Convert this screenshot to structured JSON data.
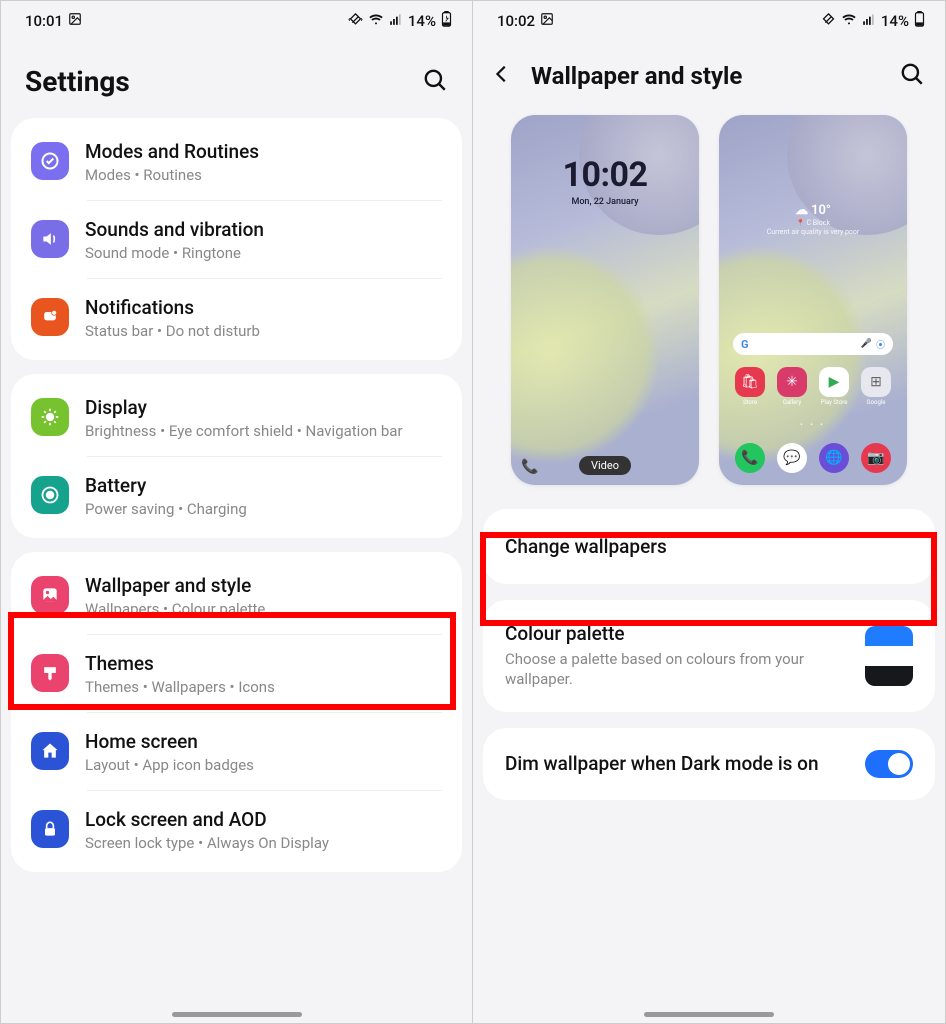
{
  "status": {
    "time_left": "10:01",
    "time_right": "10:02",
    "battery": "14%"
  },
  "left": {
    "header_title": "Settings",
    "items": [
      {
        "title": "Modes and Routines",
        "sub": "Modes  •  Routines",
        "icon": "check-circle",
        "bg": "bg-purple"
      },
      {
        "title": "Sounds and vibration",
        "sub": "Sound mode  •  Ringtone",
        "icon": "speaker",
        "bg": "bg-violet"
      },
      {
        "title": "Notifications",
        "sub": "Status bar  •  Do not disturb",
        "icon": "bell",
        "bg": "bg-orange"
      },
      {
        "title": "Display",
        "sub": "Brightness  •  Eye comfort shield  •  Navigation bar",
        "icon": "sun",
        "bg": "bg-green"
      },
      {
        "title": "Battery",
        "sub": "Power saving  •  Charging",
        "icon": "battery",
        "bg": "bg-teal"
      },
      {
        "title": "Wallpaper and style",
        "sub": "Wallpapers  •  Colour palette",
        "icon": "picture",
        "bg": "bg-pink"
      },
      {
        "title": "Themes",
        "sub": "Themes  •  Wallpapers  •  Icons",
        "icon": "brush",
        "bg": "bg-pink2"
      },
      {
        "title": "Home screen",
        "sub": "Layout  •  App icon badges",
        "icon": "home",
        "bg": "bg-blue"
      },
      {
        "title": "Lock screen and AOD",
        "sub": "Screen lock type  •  Always On Display",
        "icon": "lock",
        "bg": "bg-blue2"
      }
    ]
  },
  "right": {
    "header_title": "Wallpaper and style",
    "lock_preview": {
      "time": "10:02",
      "date": "Mon, 22 January",
      "video_label": "Video"
    },
    "home_preview": {
      "temp": "10°",
      "loc": "C Block",
      "aq": "Current air quality is very poor",
      "search_placeholder": "G",
      "top_apps": [
        "Store",
        "Gallery",
        "Play Store",
        "Google"
      ],
      "bottom_apps": [
        "Phone",
        "Messages",
        "Internet",
        "Camera"
      ]
    },
    "change_wallpapers": "Change wallpapers",
    "palette_title": "Colour palette",
    "palette_sub": "Choose a palette based on colours from your wallpaper.",
    "palette_colors": [
      "#1f7cff",
      "#ffffff",
      "#17181b"
    ],
    "dim_title": "Dim wallpaper when Dark mode is on",
    "dim_on": true
  }
}
